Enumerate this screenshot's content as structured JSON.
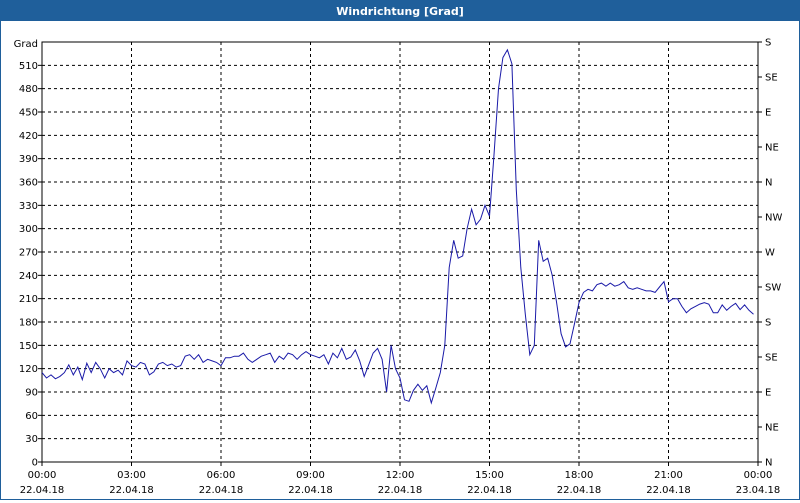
{
  "window": {
    "title": "Windrichtung [Grad]"
  },
  "chart_data": {
    "type": "line",
    "title": "Windrichtung [Grad]",
    "ylabel": "Grad",
    "ylim": [
      0,
      540
    ],
    "y_ticks": [
      0,
      30,
      60,
      90,
      120,
      150,
      180,
      210,
      240,
      270,
      300,
      330,
      360,
      390,
      420,
      450,
      480,
      510
    ],
    "y2_ticks": [
      {
        "value": 0,
        "label": "N"
      },
      {
        "value": 45,
        "label": "NE"
      },
      {
        "value": 90,
        "label": "E"
      },
      {
        "value": 135,
        "label": "SE"
      },
      {
        "value": 180,
        "label": "S"
      },
      {
        "value": 225,
        "label": "SW"
      },
      {
        "value": 270,
        "label": "W"
      },
      {
        "value": 315,
        "label": "NW"
      },
      {
        "value": 360,
        "label": "N"
      },
      {
        "value": 405,
        "label": "NE"
      },
      {
        "value": 450,
        "label": "E"
      },
      {
        "value": 495,
        "label": "SE"
      },
      {
        "value": 540,
        "label": "S"
      }
    ],
    "xlim": [
      0,
      24
    ],
    "x_ticks": [
      {
        "value": 0,
        "time": "00:00",
        "date": "22.04.18"
      },
      {
        "value": 3,
        "time": "03:00",
        "date": "22.04.18"
      },
      {
        "value": 6,
        "time": "06:00",
        "date": "22.04.18"
      },
      {
        "value": 9,
        "time": "09:00",
        "date": "22.04.18"
      },
      {
        "value": 12,
        "time": "12:00",
        "date": "22.04.18"
      },
      {
        "value": 15,
        "time": "15:00",
        "date": "22.04.18"
      },
      {
        "value": 18,
        "time": "18:00",
        "date": "22.04.18"
      },
      {
        "value": 21,
        "time": "21:00",
        "date": "22.04.18"
      },
      {
        "value": 24,
        "time": "00:00",
        "date": "23.04.18"
      }
    ],
    "grid": true,
    "line_color": "#1a1aa8",
    "series": [
      {
        "points": [
          [
            0.0,
            115
          ],
          [
            0.15,
            108
          ],
          [
            0.3,
            112
          ],
          [
            0.45,
            107
          ],
          [
            0.6,
            110
          ],
          [
            0.75,
            115
          ],
          [
            0.9,
            125
          ],
          [
            1.05,
            112
          ],
          [
            1.2,
            122
          ],
          [
            1.35,
            106
          ],
          [
            1.5,
            127
          ],
          [
            1.65,
            115
          ],
          [
            1.8,
            128
          ],
          [
            1.95,
            120
          ],
          [
            2.1,
            108
          ],
          [
            2.25,
            120
          ],
          [
            2.4,
            115
          ],
          [
            2.55,
            118
          ],
          [
            2.7,
            112
          ],
          [
            2.85,
            130
          ],
          [
            3.0,
            124
          ],
          [
            3.15,
            122
          ],
          [
            3.3,
            128
          ],
          [
            3.45,
            126
          ],
          [
            3.6,
            112
          ],
          [
            3.75,
            116
          ],
          [
            3.9,
            126
          ],
          [
            4.05,
            128
          ],
          [
            4.2,
            124
          ],
          [
            4.35,
            126
          ],
          [
            4.5,
            122
          ],
          [
            4.65,
            124
          ],
          [
            4.8,
            136
          ],
          [
            4.95,
            138
          ],
          [
            5.1,
            132
          ],
          [
            5.25,
            138
          ],
          [
            5.4,
            128
          ],
          [
            5.55,
            132
          ],
          [
            5.7,
            130
          ],
          [
            5.85,
            128
          ],
          [
            6.0,
            124
          ],
          [
            6.15,
            134
          ],
          [
            6.3,
            134
          ],
          [
            6.45,
            136
          ],
          [
            6.6,
            136
          ],
          [
            6.75,
            140
          ],
          [
            6.9,
            132
          ],
          [
            7.05,
            128
          ],
          [
            7.2,
            132
          ],
          [
            7.35,
            136
          ],
          [
            7.5,
            138
          ],
          [
            7.65,
            140
          ],
          [
            7.8,
            128
          ],
          [
            7.95,
            136
          ],
          [
            8.1,
            132
          ],
          [
            8.25,
            140
          ],
          [
            8.4,
            138
          ],
          [
            8.55,
            132
          ],
          [
            8.7,
            138
          ],
          [
            8.85,
            142
          ],
          [
            9.0,
            138
          ],
          [
            9.15,
            136
          ],
          [
            9.3,
            134
          ],
          [
            9.45,
            138
          ],
          [
            9.6,
            126
          ],
          [
            9.75,
            140
          ],
          [
            9.9,
            134
          ],
          [
            10.05,
            146
          ],
          [
            10.2,
            132
          ],
          [
            10.35,
            135
          ],
          [
            10.5,
            144
          ],
          [
            10.65,
            130
          ],
          [
            10.8,
            110
          ],
          [
            10.95,
            125
          ],
          [
            11.1,
            140
          ],
          [
            11.25,
            146
          ],
          [
            11.4,
            132
          ],
          [
            11.55,
            90
          ],
          [
            11.7,
            150
          ],
          [
            11.85,
            120
          ],
          [
            12.0,
            108
          ],
          [
            12.15,
            80
          ],
          [
            12.3,
            78
          ],
          [
            12.45,
            92
          ],
          [
            12.6,
            100
          ],
          [
            12.75,
            92
          ],
          [
            12.9,
            98
          ],
          [
            13.05,
            76
          ],
          [
            13.2,
            95
          ],
          [
            13.35,
            115
          ],
          [
            13.5,
            150
          ],
          [
            13.65,
            250
          ],
          [
            13.8,
            285
          ],
          [
            13.95,
            262
          ],
          [
            14.1,
            265
          ],
          [
            14.25,
            300
          ],
          [
            14.4,
            325
          ],
          [
            14.55,
            305
          ],
          [
            14.7,
            312
          ],
          [
            14.85,
            330
          ],
          [
            15.0,
            316
          ],
          [
            15.15,
            395
          ],
          [
            15.3,
            480
          ],
          [
            15.45,
            520
          ],
          [
            15.6,
            530
          ],
          [
            15.75,
            512
          ],
          [
            15.9,
            350
          ],
          [
            16.05,
            250
          ],
          [
            16.2,
            190
          ],
          [
            16.35,
            138
          ],
          [
            16.5,
            150
          ],
          [
            16.65,
            285
          ],
          [
            16.8,
            258
          ],
          [
            16.95,
            262
          ],
          [
            17.1,
            240
          ],
          [
            17.25,
            205
          ],
          [
            17.4,
            165
          ],
          [
            17.55,
            148
          ],
          [
            17.7,
            152
          ],
          [
            17.85,
            178
          ],
          [
            18.0,
            205
          ],
          [
            18.15,
            218
          ],
          [
            18.3,
            222
          ],
          [
            18.45,
            220
          ],
          [
            18.6,
            228
          ],
          [
            18.75,
            230
          ],
          [
            18.9,
            226
          ],
          [
            19.05,
            230
          ],
          [
            19.2,
            226
          ],
          [
            19.35,
            228
          ],
          [
            19.5,
            232
          ],
          [
            19.65,
            224
          ],
          [
            19.8,
            222
          ],
          [
            19.95,
            224
          ],
          [
            20.1,
            222
          ],
          [
            20.25,
            220
          ],
          [
            20.4,
            220
          ],
          [
            20.55,
            218
          ],
          [
            20.7,
            225
          ],
          [
            20.85,
            232
          ],
          [
            21.0,
            206
          ],
          [
            21.15,
            210
          ],
          [
            21.3,
            210
          ],
          [
            21.45,
            200
          ],
          [
            21.6,
            192
          ],
          [
            21.75,
            197
          ],
          [
            21.9,
            200
          ],
          [
            22.05,
            203
          ],
          [
            22.2,
            205
          ],
          [
            22.35,
            203
          ],
          [
            22.5,
            192
          ],
          [
            22.65,
            192
          ],
          [
            22.8,
            202
          ],
          [
            22.95,
            195
          ],
          [
            23.1,
            200
          ],
          [
            23.25,
            204
          ],
          [
            23.4,
            196
          ],
          [
            23.55,
            202
          ],
          [
            23.7,
            195
          ],
          [
            23.85,
            190
          ]
        ]
      }
    ]
  }
}
